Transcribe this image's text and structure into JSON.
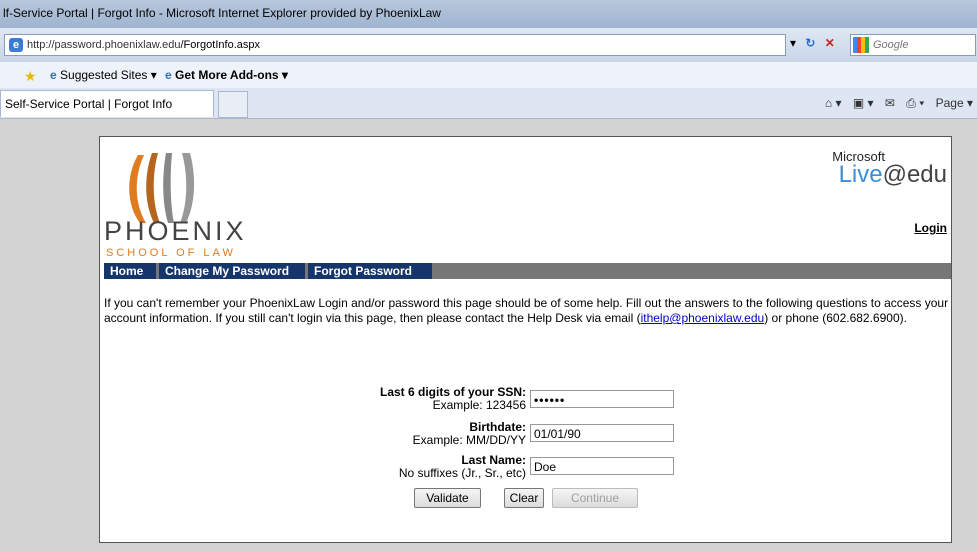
{
  "browser": {
    "title": "lf-Service Portal | Forgot Info - Microsoft Internet Explorer provided by PhoenixLaw",
    "url_host": "http://password.phoenixlaw.edu",
    "url_path": "/ForgotInfo.aspx",
    "search_placeholder": "Google",
    "favorites": {
      "suggested_sites": "Suggested Sites ▾",
      "get_more_addons": "Get More Add-ons ▾"
    },
    "tab_title": "Self-Service Portal | Forgot Info",
    "command_bar": {
      "page": "Page ▾"
    }
  },
  "page": {
    "logo_name": "PHOENIX",
    "logo_sub": "SCHOOL OF LAW",
    "brand_ms": "Microsoft",
    "brand_live": "Live",
    "brand_edu": "@edu",
    "login_link": "Login",
    "nav": [
      "Home",
      "Change My Password",
      "Forgot Password"
    ],
    "intro_1": "If you can't remember your PhoenixLaw Login and/or password this page should be of some help. Fill out the answers to the following questions to access your account information. If you still can't login via this page, then please contact the Help Desk via email (",
    "email": "ithelp@phoenixlaw.edu",
    "intro_2": ") or phone (602.682.6900).",
    "form": {
      "ssn_label": "Last 6 digits of your SSN:",
      "ssn_hint": "Example: 123456",
      "ssn_value": "••••••",
      "dob_label": "Birthdate:",
      "dob_hint": "Example: MM/DD/YY",
      "dob_value": "01/01/90",
      "last_label": "Last Name:",
      "last_hint": "No suffixes (Jr., Sr., etc)",
      "last_value": "Doe",
      "validate": "Validate",
      "clear": "Clear",
      "continue": "Continue"
    }
  },
  "colors": {
    "nav_bg": "#16356b",
    "accent_orange": "#e07b20",
    "live_blue": "#3a8fd6"
  }
}
